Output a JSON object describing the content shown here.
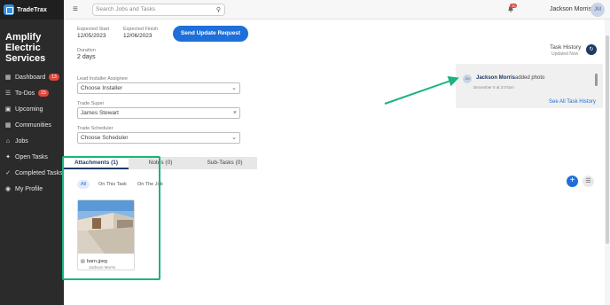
{
  "app": {
    "logo_text": "TradeTrax",
    "company": "Amplify Electric Services"
  },
  "sidebar": {
    "items": [
      {
        "label": "Dashboard",
        "icon": "dashboard-icon",
        "badge": "13"
      },
      {
        "label": "To-Dos",
        "icon": "todo-icon",
        "badge": "15"
      },
      {
        "label": "Upcoming",
        "icon": "calendar-icon",
        "badge": ""
      },
      {
        "label": "Communities",
        "icon": "communities-icon",
        "badge": ""
      },
      {
        "label": "Jobs",
        "icon": "home-icon",
        "badge": ""
      },
      {
        "label": "Open Tasks",
        "icon": "wrench-icon",
        "badge": ""
      },
      {
        "label": "Completed Tasks",
        "icon": "check-icon",
        "badge": ""
      },
      {
        "label": "My Profile",
        "icon": "profile-icon",
        "badge": ""
      }
    ]
  },
  "topbar": {
    "search_placeholder": "Search Jobs and Tasks",
    "notifications_badge": "20",
    "user_name": "Jackson Morris",
    "user_initials": "JM"
  },
  "task": {
    "expected_start_label": "Expected Start",
    "expected_start": "12/05/2023",
    "expected_finish_label": "Expected Finish",
    "expected_finish": "12/06/2023",
    "duration_label": "Duration",
    "duration": "2 days",
    "send_update_label": "Send Update Request",
    "lead_installer_label": "Lead Installer Assignee",
    "lead_installer_placeholder": "Choose Installer",
    "trade_super_label": "Trade Super",
    "trade_super_value": "James Stewart",
    "trade_scheduler_label": "Trade Scheduler",
    "trade_scheduler_placeholder": "Choose Scheduler"
  },
  "history": {
    "title": "Task History",
    "subtitle": "Updated Now",
    "entry_initials": "JM",
    "entry_user": "Jackson Morris",
    "entry_action": "added photo",
    "entry_time": "December 5 at 3:07pm",
    "see_all": "See All Task History"
  },
  "tabs": [
    {
      "label": "Attachments (1)",
      "active": true
    },
    {
      "label": "Notes (0)",
      "active": false
    },
    {
      "label": "Sub-Tasks (0)",
      "active": false
    }
  ],
  "filters": [
    {
      "label": "All",
      "active": true
    },
    {
      "label": "On This Task",
      "active": false
    },
    {
      "label": "On The Job",
      "active": false
    }
  ],
  "attachment": {
    "file_name": "barn.jpeg",
    "uploaded_by": "Jackson Morris"
  },
  "colors": {
    "primary": "#1e6fd9",
    "sidebar": "#2b2b2b",
    "highlight": "#1ab57a",
    "badge": "#e0483c"
  }
}
